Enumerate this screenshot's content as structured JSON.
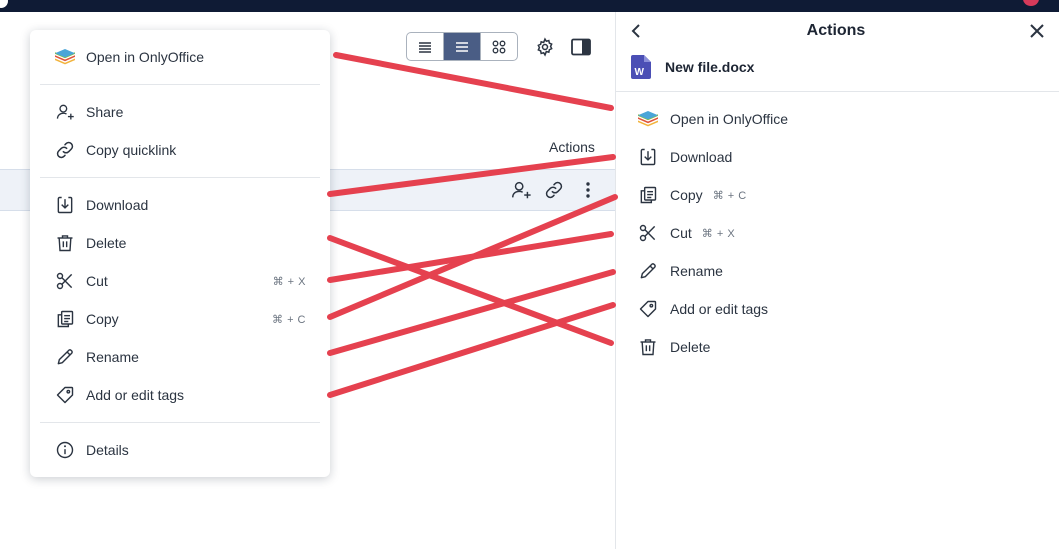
{
  "toolbar": {
    "view_modes": [
      "compact-list-icon",
      "list-icon",
      "grid-icon"
    ],
    "active_view": "list-icon",
    "settings_icon": "gear-icon",
    "panel_toggle_icon": "sidebar-toggle-icon"
  },
  "file_list": {
    "actions_header": "Actions",
    "row_action_icons": [
      "share-icon",
      "link-icon",
      "more-icon"
    ]
  },
  "context_menu": {
    "open_onlyoffice": "Open in OnlyOffice",
    "share": "Share",
    "copy_quicklink": "Copy quicklink",
    "download": "Download",
    "delete": "Delete",
    "cut": "Cut",
    "cut_shortcut": "⌘ + X",
    "copy": "Copy",
    "copy_shortcut": "⌘ + C",
    "rename": "Rename",
    "tags": "Add or edit tags",
    "details": "Details"
  },
  "actions_panel": {
    "title": "Actions",
    "file_name": "New file.docx",
    "file_icon": "word-document-icon",
    "items": {
      "open_onlyoffice": "Open in OnlyOffice",
      "download": "Download",
      "copy": "Copy",
      "copy_shortcut": "⌘ + C",
      "cut": "Cut",
      "cut_shortcut": "⌘ + X",
      "rename": "Rename",
      "tags": "Add or edit tags",
      "delete": "Delete"
    }
  },
  "annotation": {
    "line_color": "#e5414f",
    "description_colors": {
      "topbar": "#0f1b35",
      "accent": "#4a5d85",
      "selected_row": "#eef2f8"
    }
  }
}
